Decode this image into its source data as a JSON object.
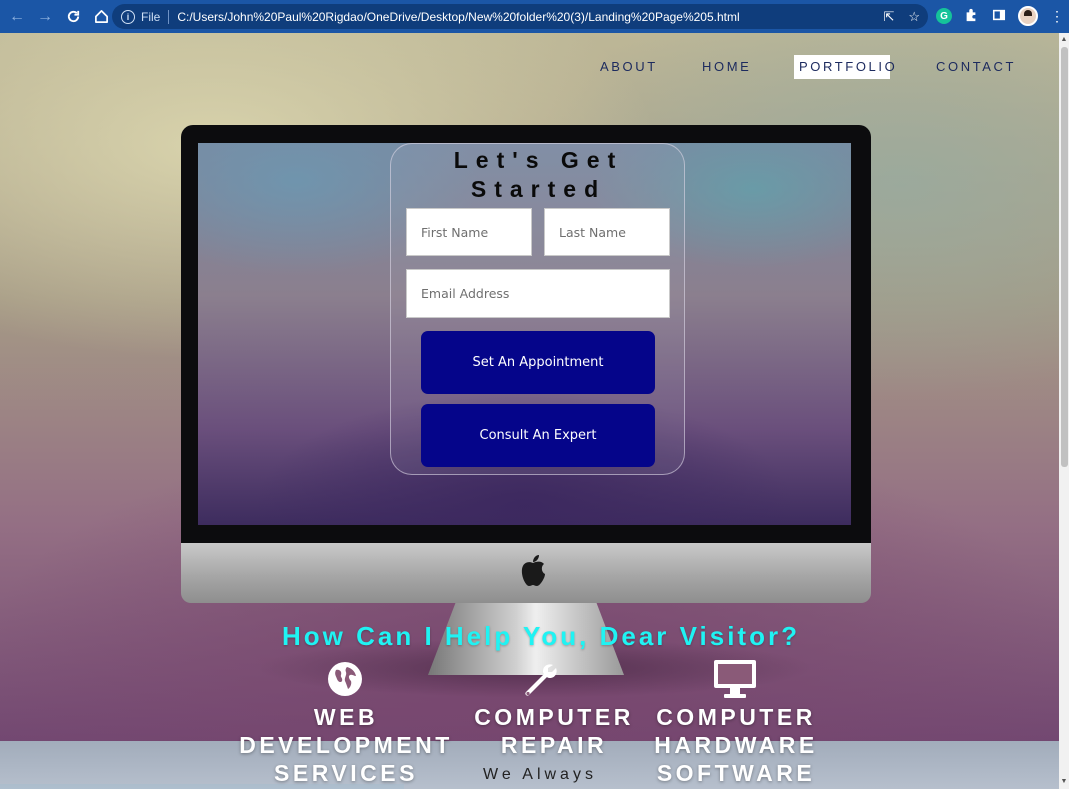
{
  "browser": {
    "scheme_label": "File",
    "url": "C:/Users/John%20Paul%20Rigdao/OneDrive/Desktop/New%20folder%20(3)/Landing%20Page%205.html",
    "extension_badge": "G"
  },
  "nav": {
    "links": [
      {
        "label": "ABOUT"
      },
      {
        "label": "HOME"
      },
      {
        "label": "PORTFOLIO",
        "active": true
      },
      {
        "label": "CONTACT"
      }
    ]
  },
  "form": {
    "title_line1": "Let's Get",
    "title_line2": "Started",
    "first_name_placeholder": "First Name",
    "last_name_placeholder": "Last Name",
    "email_placeholder": "Email Address",
    "primary_button": "Set An Appointment",
    "secondary_button": "Consult An Expert"
  },
  "services": {
    "heading": "How Can I Help You, Dear Visitor?",
    "items": [
      {
        "icon": "globe-icon",
        "lines": [
          "WEB",
          "DEVELOPMENT",
          "SERVICES"
        ]
      },
      {
        "icon": "wrench-icon",
        "lines": [
          "COMPUTER",
          "REPAIR"
        ]
      },
      {
        "icon": "monitor-icon",
        "lines": [
          "COMPUTER",
          "HARDWARE",
          "SOFTWARE"
        ]
      }
    ],
    "tagline": "We Always"
  },
  "colors": {
    "chrome_blue": "#1b56a6",
    "button_navy": "#05058a",
    "heading_cyan": "#1ff3f3",
    "nav_text": "#1c2a5e"
  }
}
